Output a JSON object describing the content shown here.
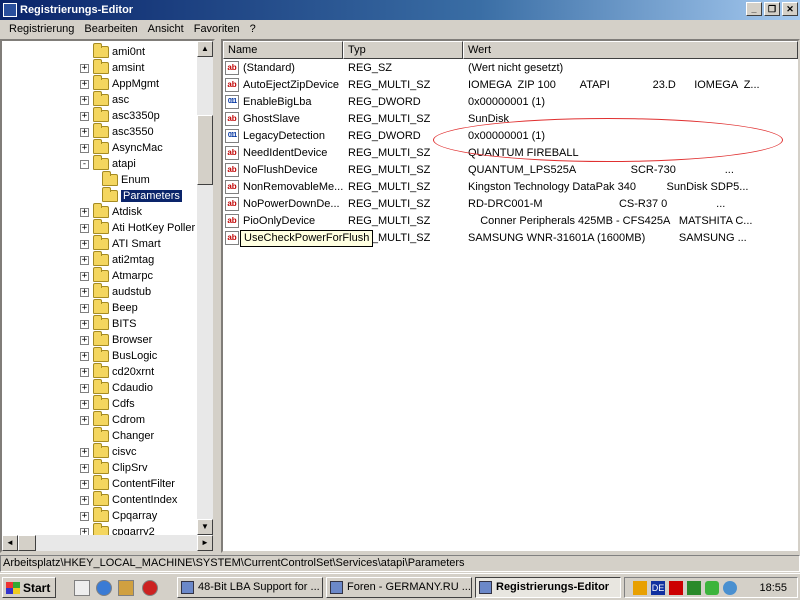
{
  "window": {
    "title": "Registrierungs-Editor"
  },
  "menu": [
    "Registrierung",
    "Bearbeiten",
    "Ansicht",
    "Favoriten",
    "?"
  ],
  "tree": [
    {
      "label": "ami0nt",
      "expander": "",
      "level": 0
    },
    {
      "label": "amsint",
      "expander": "+",
      "level": 0
    },
    {
      "label": "AppMgmt",
      "expander": "+",
      "level": 0
    },
    {
      "label": "asc",
      "expander": "+",
      "level": 0
    },
    {
      "label": "asc3350p",
      "expander": "+",
      "level": 0
    },
    {
      "label": "asc3550",
      "expander": "+",
      "level": 0
    },
    {
      "label": "AsyncMac",
      "expander": "+",
      "level": 0
    },
    {
      "label": "atapi",
      "expander": "-",
      "level": 0
    },
    {
      "label": "Enum",
      "expander": "",
      "level": 1
    },
    {
      "label": "Parameters",
      "expander": "",
      "level": 1,
      "selected": true
    },
    {
      "label": "Atdisk",
      "expander": "+",
      "level": 0
    },
    {
      "label": "Ati HotKey Poller",
      "expander": "+",
      "level": 0
    },
    {
      "label": "ATI Smart",
      "expander": "+",
      "level": 0
    },
    {
      "label": "ati2mtag",
      "expander": "+",
      "level": 0
    },
    {
      "label": "Atmarpc",
      "expander": "+",
      "level": 0
    },
    {
      "label": "audstub",
      "expander": "+",
      "level": 0
    },
    {
      "label": "Beep",
      "expander": "+",
      "level": 0
    },
    {
      "label": "BITS",
      "expander": "+",
      "level": 0
    },
    {
      "label": "Browser",
      "expander": "+",
      "level": 0
    },
    {
      "label": "BusLogic",
      "expander": "+",
      "level": 0
    },
    {
      "label": "cd20xrnt",
      "expander": "+",
      "level": 0
    },
    {
      "label": "Cdaudio",
      "expander": "+",
      "level": 0
    },
    {
      "label": "Cdfs",
      "expander": "+",
      "level": 0
    },
    {
      "label": "Cdrom",
      "expander": "+",
      "level": 0
    },
    {
      "label": "Changer",
      "expander": "",
      "level": 0
    },
    {
      "label": "cisvc",
      "expander": "+",
      "level": 0
    },
    {
      "label": "ClipSrv",
      "expander": "+",
      "level": 0
    },
    {
      "label": "ContentFilter",
      "expander": "+",
      "level": 0
    },
    {
      "label": "ContentIndex",
      "expander": "+",
      "level": 0
    },
    {
      "label": "Cpqarray",
      "expander": "+",
      "level": 0
    },
    {
      "label": "cpqarry2",
      "expander": "+",
      "level": 0
    }
  ],
  "list": {
    "columns": [
      "Name",
      "Typ",
      "Wert"
    ],
    "rows": [
      {
        "icon": "ab",
        "name": "(Standard)",
        "type": "REG_SZ",
        "value": "(Wert nicht gesetzt)"
      },
      {
        "icon": "ab",
        "name": "AutoEjectZipDevice",
        "type": "REG_MULTI_SZ",
        "value": "IOMEGA  ZIP 100        ATAPI              23.D      IOMEGA  Z..."
      },
      {
        "icon": "bin",
        "name": "EnableBigLba",
        "type": "REG_DWORD",
        "value": "0x00000001 (1)"
      },
      {
        "icon": "ab",
        "name": "GhostSlave",
        "type": "REG_MULTI_SZ",
        "value": "SunDisk"
      },
      {
        "icon": "bin",
        "name": "LegacyDetection",
        "type": "REG_DWORD",
        "value": "0x00000001 (1)"
      },
      {
        "icon": "ab",
        "name": "NeedIdentDevice",
        "type": "REG_MULTI_SZ",
        "value": "QUANTUM FIREBALL"
      },
      {
        "icon": "ab",
        "name": "NoFlushDevice",
        "type": "REG_MULTI_SZ",
        "value": "QUANTUM_LPS525A                  SCR-730                ..."
      },
      {
        "icon": "ab",
        "name": "NonRemovableMe...",
        "type": "REG_MULTI_SZ",
        "value": "Kingston Technology DataPak 340          SunDisk SDP5..."
      },
      {
        "icon": "ab",
        "name": "NoPowerDownDe...",
        "type": "REG_MULTI_SZ",
        "value": "RD-DRC001-M                         CS-R37 0                ..."
      },
      {
        "icon": "ab",
        "name": "PioOnlyDevice",
        "type": "REG_MULTI_SZ",
        "value": "    Conner Peripherals 425MB - CFS425A   MATSHITA C..."
      },
      {
        "icon": "ab",
        "name": "UseCheckPowerForFlush",
        "type": "REG_MULTI_SZ",
        "value": "SAMSUNG WNR-31601A (1600MB)           SAMSUNG ..."
      }
    ],
    "tooltip": "UseCheckPowerForFlush"
  },
  "statusbar": "Arbeitsplatz\\HKEY_LOCAL_MACHINE\\SYSTEM\\CurrentControlSet\\Services\\atapi\\Parameters",
  "taskbar": {
    "start": "Start",
    "tasks": [
      "48-Bit LBA Support for ...",
      "Foren - GERMANY.RU ...",
      "Registrierungs-Editor"
    ],
    "lang": "DE",
    "clock": "18:55"
  },
  "colors": {
    "selection": "#0a246a",
    "title_gradient_start": "#0a246a",
    "annotation_ellipse": "#e03030"
  }
}
